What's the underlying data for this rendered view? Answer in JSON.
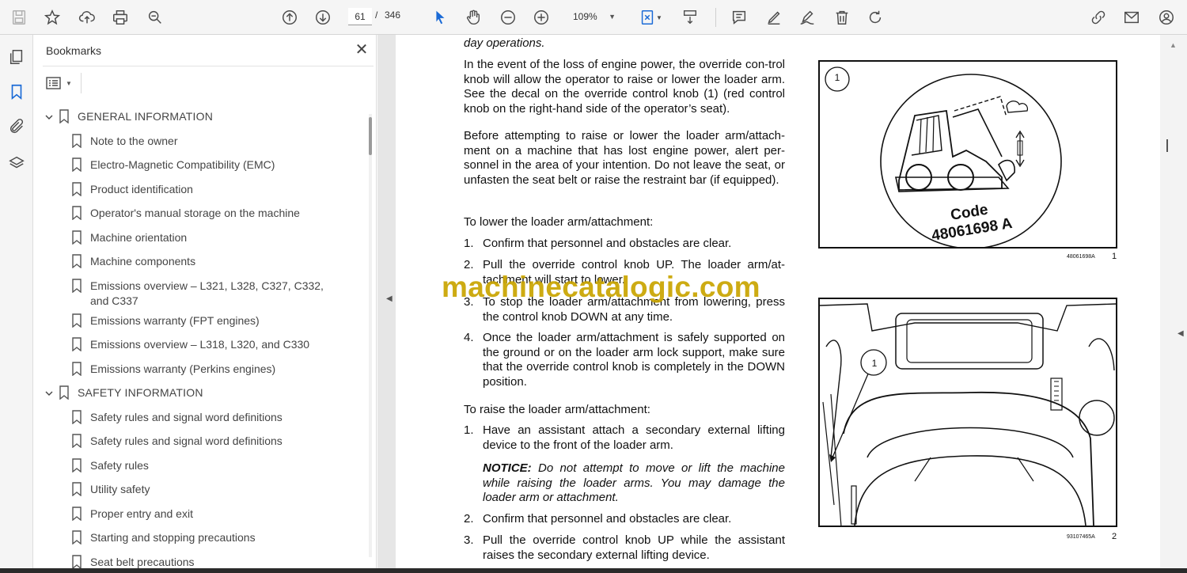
{
  "toolbar": {
    "page_current": "61",
    "page_separator": "/",
    "page_total": "346",
    "zoom": "109%",
    "icons": [
      "save-icon",
      "star-icon",
      "upload-icon",
      "print-icon",
      "zoom-search-icon",
      "page-up-icon",
      "page-down-icon",
      "select-cursor-icon",
      "hand-icon",
      "zoom-out-icon",
      "zoom-in-icon",
      "fit-page-icon",
      "scroll-mode-icon",
      "comment-icon",
      "highlight-pen-icon",
      "sign-icon",
      "delete-icon",
      "rotate-icon",
      "link-sign-icon",
      "email-icon",
      "account-icon"
    ]
  },
  "rail": {
    "icons": [
      "pages-icon",
      "bookmark-icon",
      "attachment-icon",
      "layers-icon"
    ]
  },
  "bookmarks": {
    "title": "Bookmarks",
    "close": "✕",
    "items": [
      {
        "level": 1,
        "label": "GENERAL INFORMATION",
        "expanded": true
      },
      {
        "level": 2,
        "label": "Note to the owner"
      },
      {
        "level": 2,
        "label": "Electro-Magnetic Compatibility (EMC)"
      },
      {
        "level": 2,
        "label": "Product identification"
      },
      {
        "level": 2,
        "label": "Operator's manual storage on the machine"
      },
      {
        "level": 2,
        "label": "Machine orientation"
      },
      {
        "level": 2,
        "label": "Machine components"
      },
      {
        "level": 2,
        "label": "Emissions overview  – L321, L328, C327, C332, and C337"
      },
      {
        "level": 2,
        "label": "Emissions warranty (FPT engines)"
      },
      {
        "level": 2,
        "label": "Emissions overview  – L318, L320, and C330"
      },
      {
        "level": 2,
        "label": "Emissions warranty (Perkins engines)"
      },
      {
        "level": 1,
        "label": "SAFETY INFORMATION",
        "expanded": true
      },
      {
        "level": 2,
        "label": "Safety rules and signal word definitions"
      },
      {
        "level": 2,
        "label": "Safety rules and signal word definitions"
      },
      {
        "level": 2,
        "label": "Safety rules"
      },
      {
        "level": 2,
        "label": "Utility safety"
      },
      {
        "level": 2,
        "label": "Proper entry and exit"
      },
      {
        "level": 2,
        "label": "Starting and stopping precautions"
      },
      {
        "level": 2,
        "label": "Seat belt precautions"
      }
    ]
  },
  "document": {
    "top_line": "day operations.",
    "para1": "In the event of the loss of engine power, the override con-trol knob will allow the operator to raise or lower the loader arm. See the decal on the override control knob (1) (red control knob on the right-hand side of the operator’s seat).",
    "para2": "Before attempting to raise or lower the loader arm/attach-ment on a machine that has lost engine power, alert per-sonnel in the area of your intention. Do not leave the seat, or unfasten the seat belt or raise the restraint bar (if equipped).",
    "lower_heading": "To lower the loader arm/attachment:",
    "lower_steps": [
      {
        "n": "1.",
        "t": "Confirm that personnel and obstacles are clear."
      },
      {
        "n": "2.",
        "t": "Pull the override control knob UP. The loader arm/at-tachment will start to lower."
      },
      {
        "n": "3.",
        "t": "To stop the loader arm/attachment from lowering, press the control knob DOWN at any time."
      },
      {
        "n": "4.",
        "t": "Once the loader arm/attachment is safely supported on the ground or on the loader arm lock support, make sure that the override control knob is completely in the DOWN position."
      }
    ],
    "raise_heading": "To raise the loader arm/attachment:",
    "raise_steps": [
      {
        "n": "1.",
        "t": "Have an assistant attach a secondary external lifting device to the front of the loader arm."
      },
      {
        "n": "2.",
        "t": "Confirm that personnel and obstacles are clear."
      },
      {
        "n": "3.",
        "t": "Pull the override control knob UP while the assistant raises the secondary external lifting device."
      }
    ],
    "notice_label": "NOTICE:",
    "notice_text": " Do not attempt to move or lift the machine while raising the loader arms. You may damage the loader arm or attachment.",
    "figure1": {
      "callout": "1",
      "code_label": "Code",
      "code_value": "48061698 A",
      "caption": "48061698A",
      "number": "1"
    },
    "figure2": {
      "callout": "1",
      "caption": "93107465A",
      "number": "2"
    }
  },
  "watermark": "machinecatalogic.com"
}
